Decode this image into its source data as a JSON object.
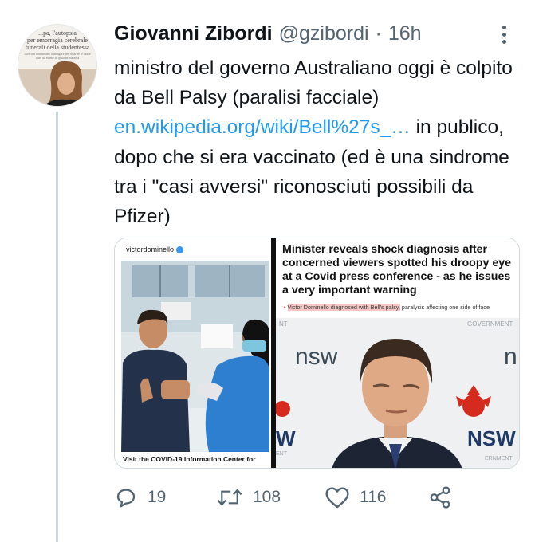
{
  "tweet": {
    "author_name": "Giovanni Zibordi",
    "handle": "@gzibordi",
    "separator": "·",
    "time": "16h",
    "text_part1": "ministro del governo Australiano oggi è colpito da Bell Palsy (paralisi facciale) ",
    "link": "en.wikipedia.org/wiki/Bell%27s_…",
    "text_part2": " in publico, dopo che si era vaccinato (ed è una sindrome tra i \"casi avversi\" riconosciuti possibili da Pfizer)"
  },
  "avatar": {
    "overlay_line1": "...pa, l'autopsia",
    "overlay_line2": "per emorragia cerebrale",
    "overlay_line3": "funerali della studentessa",
    "overlay_small": "Ulteriori continuano a indagare per chiarire le cause",
    "overlay_small2": "oltre all'esame di qualche malattia"
  },
  "media": {
    "left": {
      "account": "victordominello",
      "caption": "Visit the COVID-19 Information Center for"
    },
    "right": {
      "headline": "Minister reveals shock diagnosis after concerned viewers spotted his droopy eye at a Covid press conference - as he issues a very important warning",
      "bullet": "•",
      "sub_highlight": "Victor Dominello diagnosed with Bell's palsy,",
      "sub_rest": " paralysis affecting one side of face",
      "sign_left_top": "NT",
      "sign_right_top": "GOVERNMENT",
      "sign_nsw_left": "nsw",
      "sign_nsw_right": "n",
      "sign_nsw_big": "NSW",
      "sign_nsw_big_left": "W",
      "sign_bottom_left": "ENT",
      "sign_bottom_right": "ERNMENT"
    }
  },
  "actions": {
    "reply_count": "19",
    "retweet_count": "108",
    "like_count": "116"
  },
  "colors": {
    "link": "#1d9bf0",
    "secondary_text": "#536471",
    "thread_line": "#cfd9de"
  }
}
